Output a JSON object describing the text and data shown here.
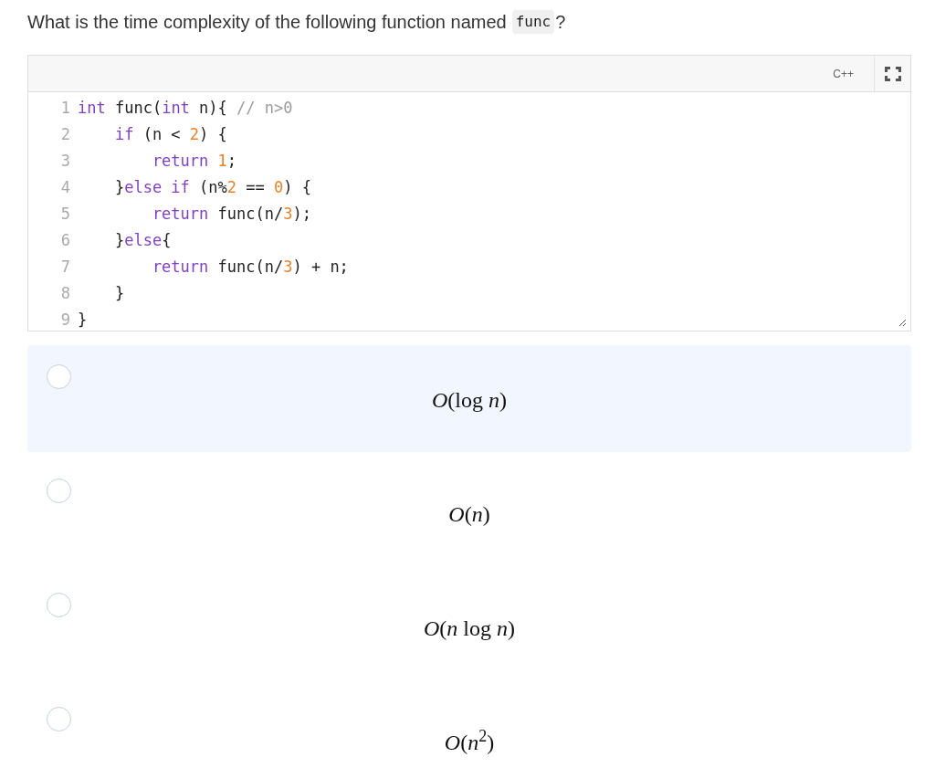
{
  "question": {
    "prefix": "What is the time complexity of the following function named",
    "code": "func",
    "suffix": "?"
  },
  "editor": {
    "language": "C++",
    "lines": [
      [
        {
          "kind": "keyword",
          "text": "int"
        },
        {
          "kind": "plain",
          "text": " func("
        },
        {
          "kind": "keyword",
          "text": "int"
        },
        {
          "kind": "plain",
          "text": " n){ "
        },
        {
          "kind": "comment",
          "text": "// n>0"
        }
      ],
      [
        {
          "kind": "keyword",
          "text": "    if"
        },
        {
          "kind": "plain",
          "text": " (n < "
        },
        {
          "kind": "number",
          "text": "2"
        },
        {
          "kind": "plain",
          "text": ") {"
        }
      ],
      [
        {
          "kind": "keyword",
          "text": "        return"
        },
        {
          "kind": "number",
          "text": " 1"
        },
        {
          "kind": "plain",
          "text": ";"
        }
      ],
      [
        {
          "kind": "plain",
          "text": "    }"
        },
        {
          "kind": "keyword",
          "text": "else if"
        },
        {
          "kind": "plain",
          "text": " (n%"
        },
        {
          "kind": "number",
          "text": "2"
        },
        {
          "kind": "plain",
          "text": " == "
        },
        {
          "kind": "number",
          "text": "0"
        },
        {
          "kind": "plain",
          "text": ") {"
        }
      ],
      [
        {
          "kind": "keyword",
          "text": "        return"
        },
        {
          "kind": "plain",
          "text": " func(n/"
        },
        {
          "kind": "number",
          "text": "3"
        },
        {
          "kind": "plain",
          "text": ");"
        }
      ],
      [
        {
          "kind": "plain",
          "text": "    }"
        },
        {
          "kind": "keyword",
          "text": "else"
        },
        {
          "kind": "plain",
          "text": "{"
        }
      ],
      [
        {
          "kind": "keyword",
          "text": "        return"
        },
        {
          "kind": "plain",
          "text": " func(n/"
        },
        {
          "kind": "number",
          "text": "3"
        },
        {
          "kind": "plain",
          "text": ") + n;"
        }
      ],
      [
        {
          "kind": "plain",
          "text": "    }"
        }
      ],
      [
        {
          "kind": "plain",
          "text": "}"
        }
      ]
    ],
    "line_numbers": [
      "1",
      "2",
      "3",
      "4",
      "5",
      "6",
      "7",
      "8",
      "9"
    ]
  },
  "options": [
    {
      "label": "*O*(log *n*)",
      "selected": false,
      "highlighted": true
    },
    {
      "label": "*O*(*n*)",
      "selected": false,
      "highlighted": false
    },
    {
      "label": "*O*(*n* log *n*)",
      "selected": false,
      "highlighted": false
    },
    {
      "label": "*O*(*n*$^{2}$)",
      "selected": false,
      "highlighted": false
    }
  ]
}
